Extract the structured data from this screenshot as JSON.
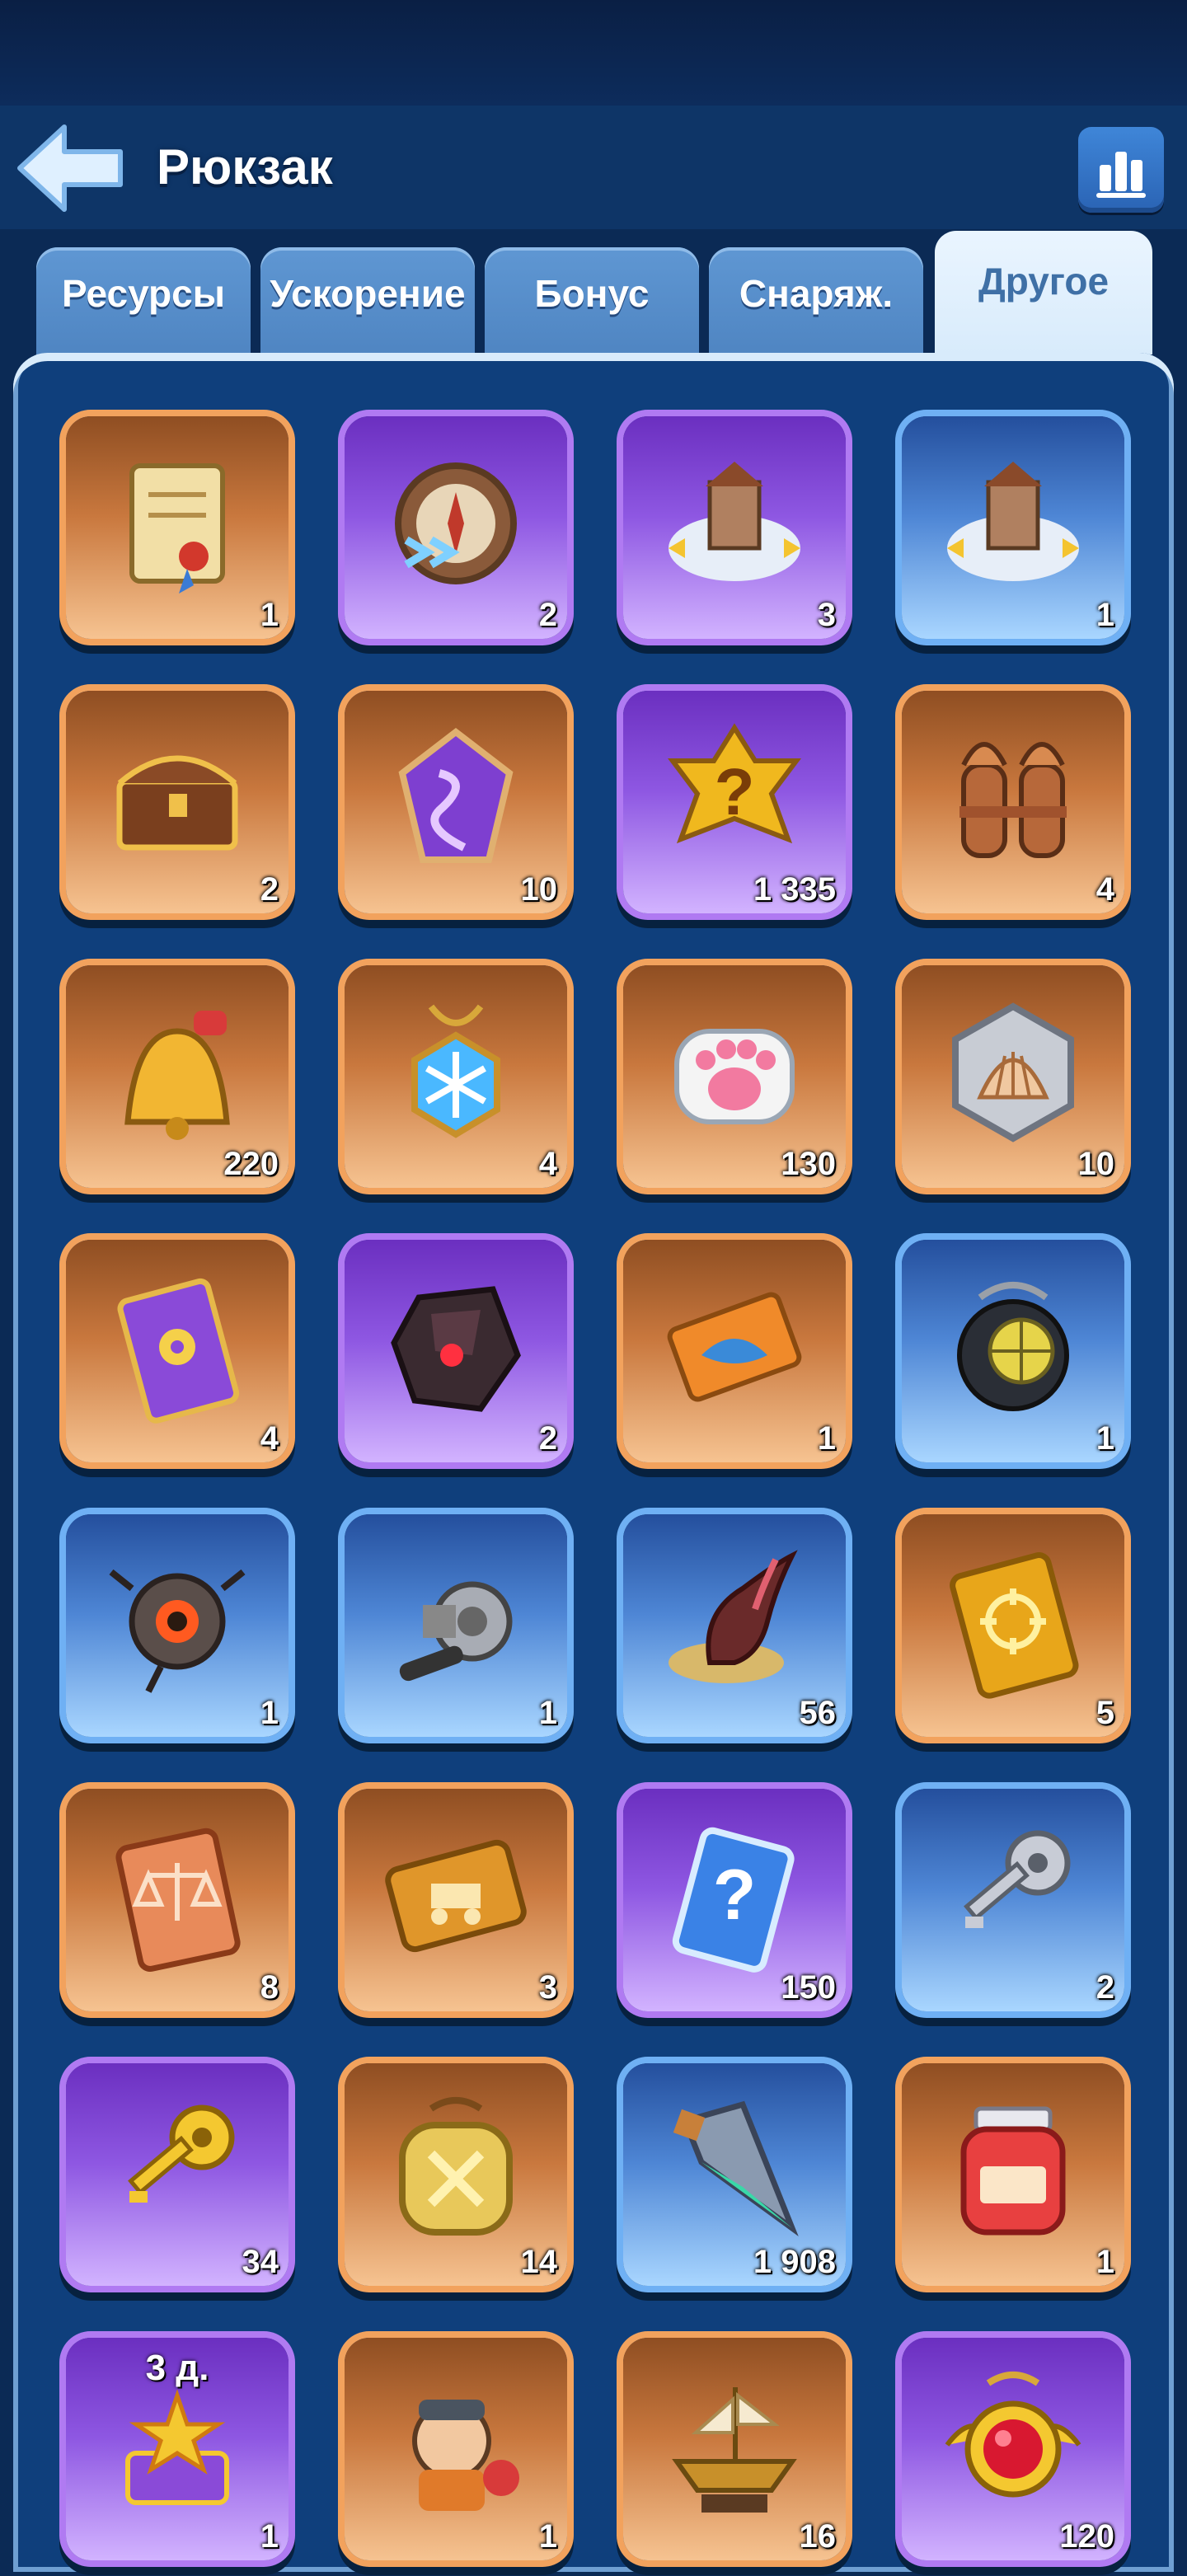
{
  "header": {
    "title": "Рюкзак"
  },
  "tabs": [
    {
      "label": "Ресурсы",
      "active": false
    },
    {
      "label": "Ускорение",
      "active": false
    },
    {
      "label": "Бонус",
      "active": false
    },
    {
      "label": "Снаряж.",
      "active": false
    },
    {
      "label": "Другое",
      "active": true
    }
  ],
  "items": [
    {
      "icon": "scroll-icon",
      "rarity": "orange",
      "count": "1"
    },
    {
      "icon": "compass-speed-icon",
      "rarity": "purple",
      "count": "2"
    },
    {
      "icon": "building-relocate-icon",
      "rarity": "purple",
      "count": "3"
    },
    {
      "icon": "building-relocate-icon",
      "rarity": "blue",
      "count": "1"
    },
    {
      "icon": "treasure-chest-icon",
      "rarity": "orange",
      "count": "2"
    },
    {
      "icon": "rune-stone-icon",
      "rarity": "orange",
      "count": "10"
    },
    {
      "icon": "mystery-badge-icon",
      "rarity": "purple",
      "count": "1 335"
    },
    {
      "icon": "rocket-boosters-icon",
      "rarity": "orange",
      "count": "4"
    },
    {
      "icon": "bell-icon",
      "rarity": "orange",
      "count": "220"
    },
    {
      "icon": "snowflake-amulet-icon",
      "rarity": "orange",
      "count": "4"
    },
    {
      "icon": "paw-token-icon",
      "rarity": "orange",
      "count": "130"
    },
    {
      "icon": "shell-token-icon",
      "rarity": "orange",
      "count": "10"
    },
    {
      "icon": "flower-card-icon",
      "rarity": "orange",
      "count": "4"
    },
    {
      "icon": "dark-ore-icon",
      "rarity": "purple",
      "count": "2"
    },
    {
      "icon": "fish-ticket-icon",
      "rarity": "orange",
      "count": "1"
    },
    {
      "icon": "diving-helmet-icon",
      "rarity": "blue",
      "count": "1"
    },
    {
      "icon": "robot-drone-icon",
      "rarity": "blue",
      "count": "1"
    },
    {
      "icon": "fishing-reel-icon",
      "rarity": "blue",
      "count": "1"
    },
    {
      "icon": "claw-horn-icon",
      "rarity": "blue",
      "count": "56"
    },
    {
      "icon": "target-ticket-icon",
      "rarity": "orange",
      "count": "5"
    },
    {
      "icon": "scales-ticket-icon",
      "rarity": "orange",
      "count": "8"
    },
    {
      "icon": "tank-ticket-icon",
      "rarity": "orange",
      "count": "3"
    },
    {
      "icon": "mystery-card-icon",
      "rarity": "purple",
      "count": "150"
    },
    {
      "icon": "silver-key-icon",
      "rarity": "blue",
      "count": "2"
    },
    {
      "icon": "gold-key-icon",
      "rarity": "purple",
      "count": "34"
    },
    {
      "icon": "sword-medal-icon",
      "rarity": "orange",
      "count": "14"
    },
    {
      "icon": "crystal-shard-icon",
      "rarity": "blue",
      "count": "1 908"
    },
    {
      "icon": "jam-jar-icon",
      "rarity": "orange",
      "count": "1"
    },
    {
      "icon": "star-chest-icon",
      "rarity": "purple",
      "count": "1",
      "timer": "3 д."
    },
    {
      "icon": "hero-portrait-icon",
      "rarity": "orange",
      "count": "1"
    },
    {
      "icon": "ship-statue-icon",
      "rarity": "orange",
      "count": "16"
    },
    {
      "icon": "ruby-amulet-icon",
      "rarity": "purple",
      "count": "120"
    }
  ]
}
